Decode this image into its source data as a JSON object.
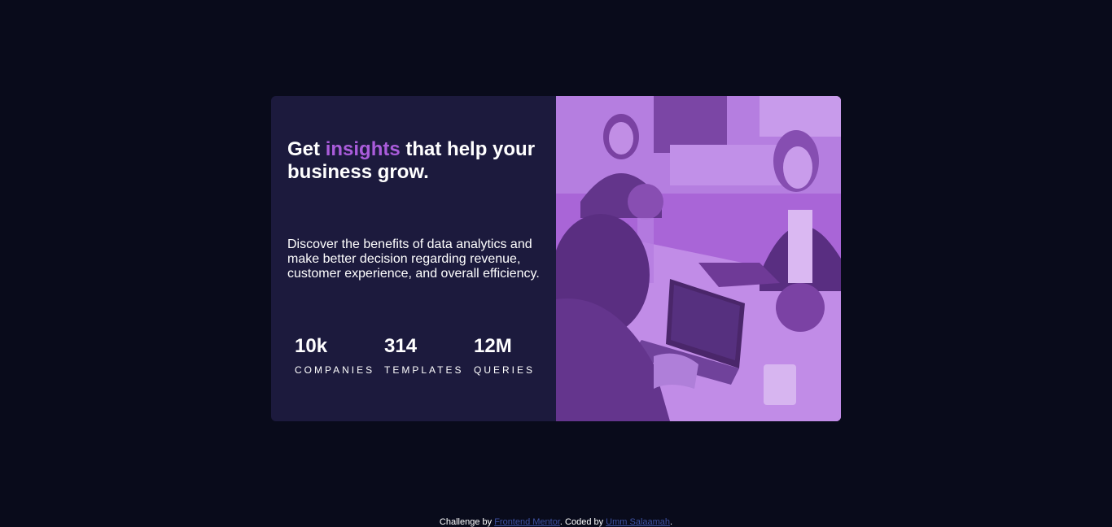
{
  "card": {
    "heading": {
      "before": "Get ",
      "accent": "insights",
      "after": " that help your business grow."
    },
    "description": "Discover the benefits of data analytics and make better decision regarding revenue, customer experience, and overall efficiency.",
    "stats": [
      {
        "value": "10k",
        "label": "COMPANIES"
      },
      {
        "value": "314",
        "label": "TEMPLATES"
      },
      {
        "value": "12M",
        "label": "QUERIES"
      }
    ],
    "image": {
      "alt": "people working on laptops",
      "tint": "#aa5cdb"
    }
  },
  "footer": {
    "challenge_text": "Challenge by ",
    "challenge_link": "Frontend Mentor",
    "coded_text": ". Coded by ",
    "author_link": "Umm Salaamah",
    "end_text": "."
  },
  "colors": {
    "background": "#090b1b",
    "card": "#1c1a3d",
    "accent": "#aa5cdb",
    "link": "#3e52a3"
  }
}
